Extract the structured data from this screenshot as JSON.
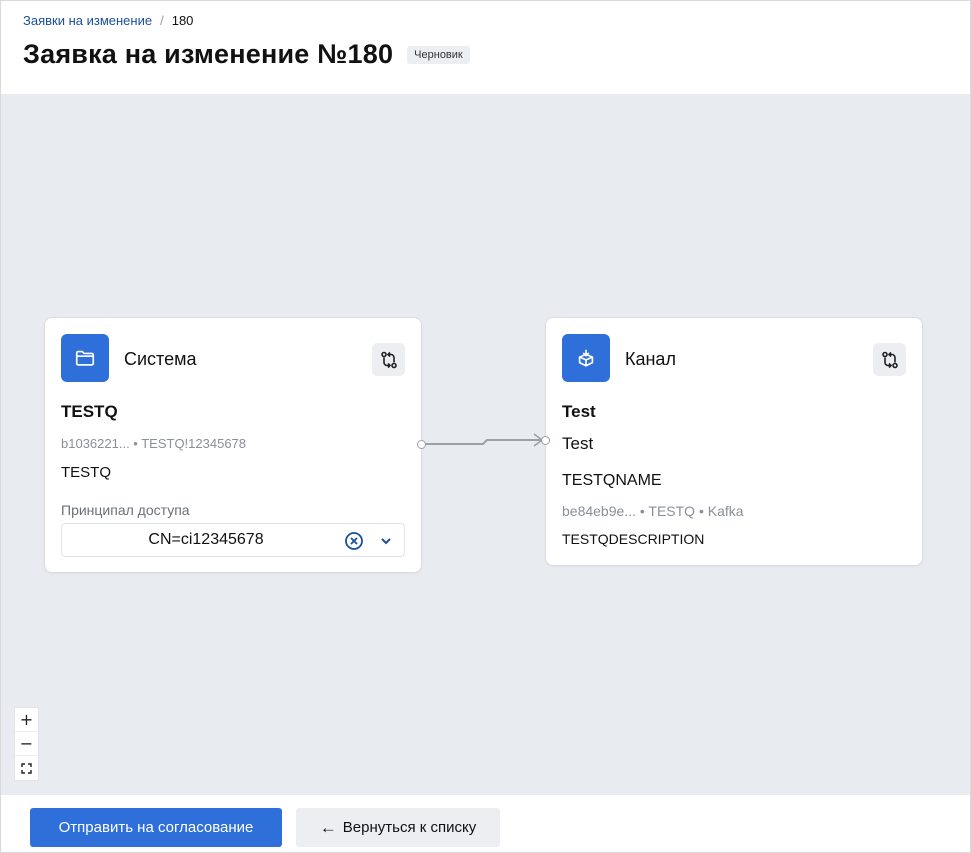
{
  "breadcrumb": {
    "parent": "Заявки на изменение",
    "separator": "/",
    "current": "180"
  },
  "page": {
    "title": "Заявка на изменение №180",
    "status": "Черновик"
  },
  "nodes": {
    "system": {
      "type_label": "Система",
      "icon": "folder-icon",
      "name": "TESTQ",
      "meta": "b1036221... • TESTQ!12345678",
      "description": "TESTQ",
      "principal_label": "Принципал доступа",
      "principal_value": "CN=ci12345678"
    },
    "channel": {
      "type_label": "Канал",
      "icon": "box-icon",
      "name": "Test",
      "subtitle": "Test",
      "topic_name": "TESTQNAME",
      "meta": "be84eb9e... • TESTQ • Kafka",
      "description": "TESTQDESCRIPTION"
    }
  },
  "zoom": {
    "in": "+",
    "out": "−",
    "fit": "⛶"
  },
  "footer": {
    "submit_label": "Отправить на согласование",
    "back_label": "Вернуться к списку",
    "back_arrow": "←"
  },
  "colors": {
    "accent": "#2f6fd9",
    "canvas": "#e8ebef",
    "link": "#1a4f9c"
  }
}
